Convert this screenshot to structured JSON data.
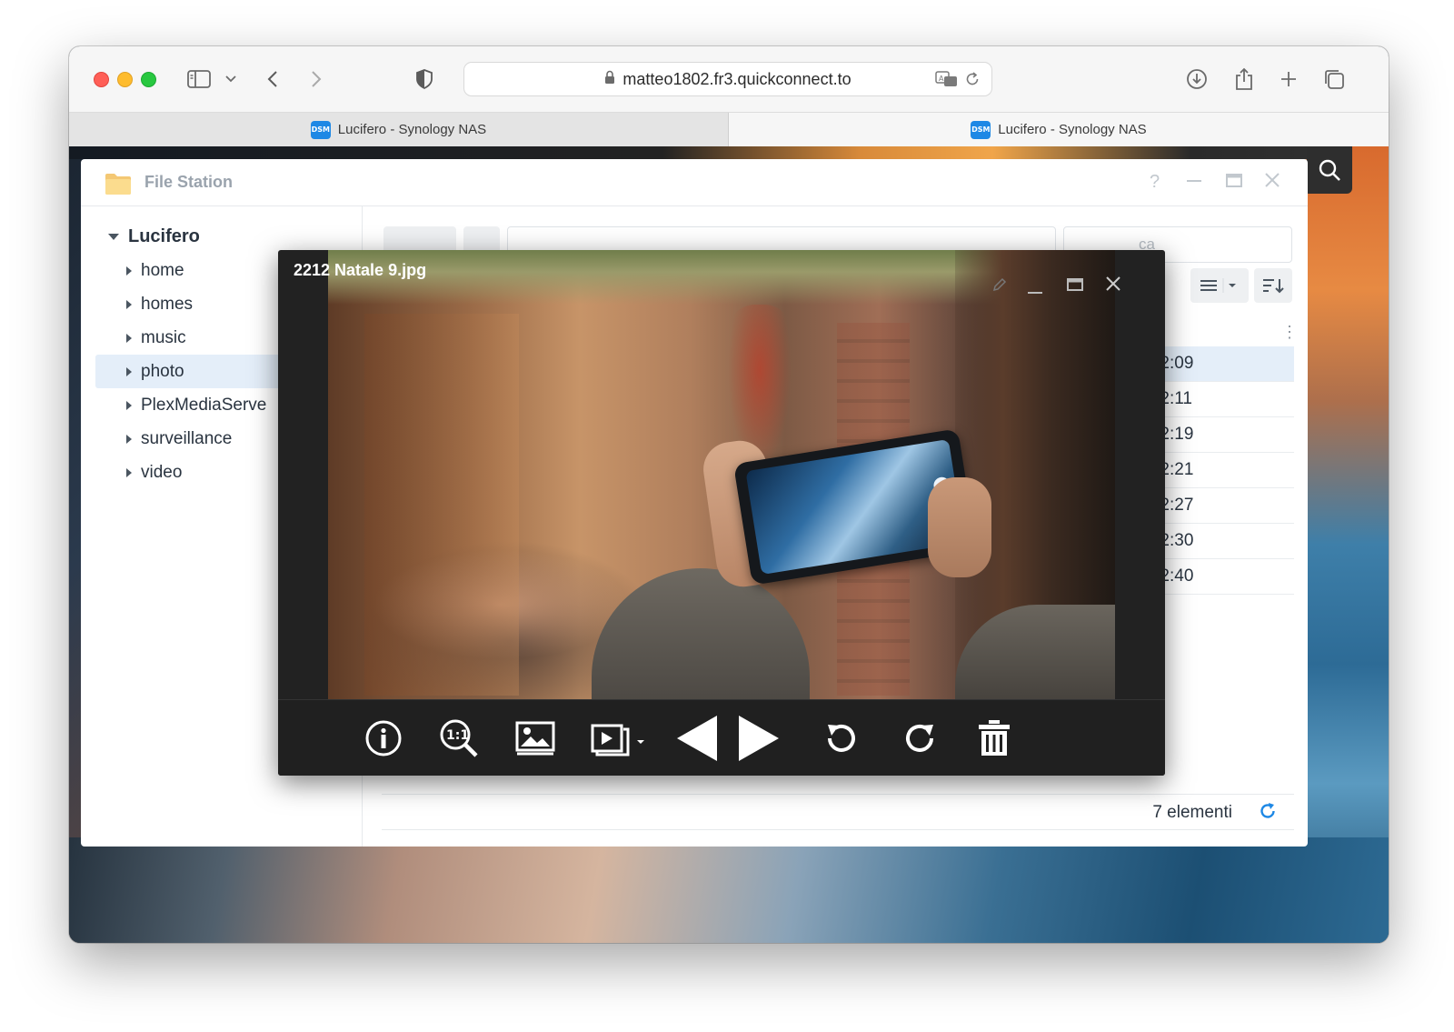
{
  "browser": {
    "url": "matteo1802.fr3.quickconnect.to",
    "tabs": [
      {
        "label": "Lucifero - Synology NAS",
        "icon": "DSM"
      },
      {
        "label": "Lucifero - Synology NAS",
        "icon": "DSM"
      }
    ]
  },
  "file_station": {
    "title": "File Station",
    "tree": {
      "root": "Lucifero",
      "items": [
        {
          "label": "home"
        },
        {
          "label": "homes"
        },
        {
          "label": "music"
        },
        {
          "label": "photo",
          "selected": true
        },
        {
          "label": "PlexMediaServe"
        },
        {
          "label": "surveillance"
        },
        {
          "label": "video"
        }
      ]
    },
    "search_placeholder": "ca",
    "rows": [
      {
        "time": "7:52:09"
      },
      {
        "time": "7:52:11"
      },
      {
        "time": "7:52:19"
      },
      {
        "time": "7:52:21"
      },
      {
        "time": "7:52:27"
      },
      {
        "time": "7:52:30"
      },
      {
        "time": "7:52:40"
      }
    ],
    "status": {
      "count": "7 elementi"
    }
  },
  "viewer": {
    "title": "2212 Natale 9.jpg",
    "buttons": [
      "info-icon",
      "zoom-actual-size-icon",
      "wallpaper-icon",
      "slideshow-icon",
      "previous-icon",
      "next-icon",
      "rotate-left-icon",
      "rotate-right-icon",
      "trash-icon"
    ]
  },
  "colors": {
    "accent": "#1e88e5",
    "selection": "#e4eef9",
    "viewer_bg": "#222222"
  }
}
